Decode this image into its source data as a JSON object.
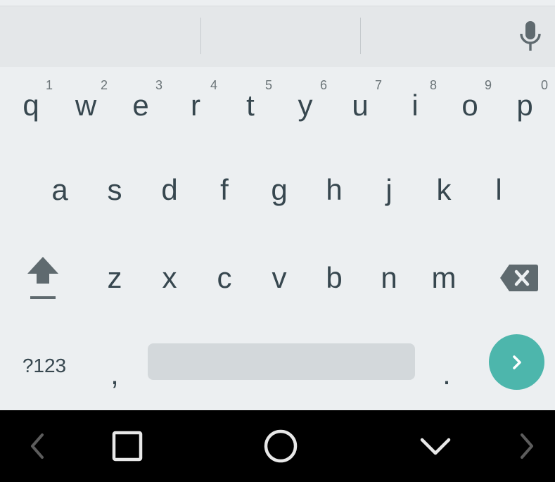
{
  "rows": {
    "row1": [
      {
        "letter": "q",
        "hint": "1"
      },
      {
        "letter": "w",
        "hint": "2"
      },
      {
        "letter": "e",
        "hint": "3"
      },
      {
        "letter": "r",
        "hint": "4"
      },
      {
        "letter": "t",
        "hint": "5"
      },
      {
        "letter": "y",
        "hint": "6"
      },
      {
        "letter": "u",
        "hint": "7"
      },
      {
        "letter": "i",
        "hint": "8"
      },
      {
        "letter": "o",
        "hint": "9"
      },
      {
        "letter": "p",
        "hint": "0"
      }
    ],
    "row2": [
      "a",
      "s",
      "d",
      "f",
      "g",
      "h",
      "j",
      "k",
      "l"
    ],
    "row3": [
      "z",
      "x",
      "c",
      "v",
      "b",
      "n",
      "m"
    ]
  },
  "bottom": {
    "symbols_label": "?123",
    "comma": ",",
    "period": "."
  },
  "icons": {
    "mic": "microphone-icon",
    "shift": "shift-icon",
    "backspace": "backspace-icon",
    "enter": "chevron-right-icon",
    "nav_back": "chevron-left-icon",
    "nav_recents": "square-icon",
    "nav_home": "circle-icon",
    "nav_hide": "chevron-down-icon",
    "nav_forward": "chevron-right-icon"
  },
  "colors": {
    "key_text": "#37474f",
    "accent": "#4db6ac",
    "keyboard_bg": "#eceff1",
    "nav_bg": "#000000"
  }
}
